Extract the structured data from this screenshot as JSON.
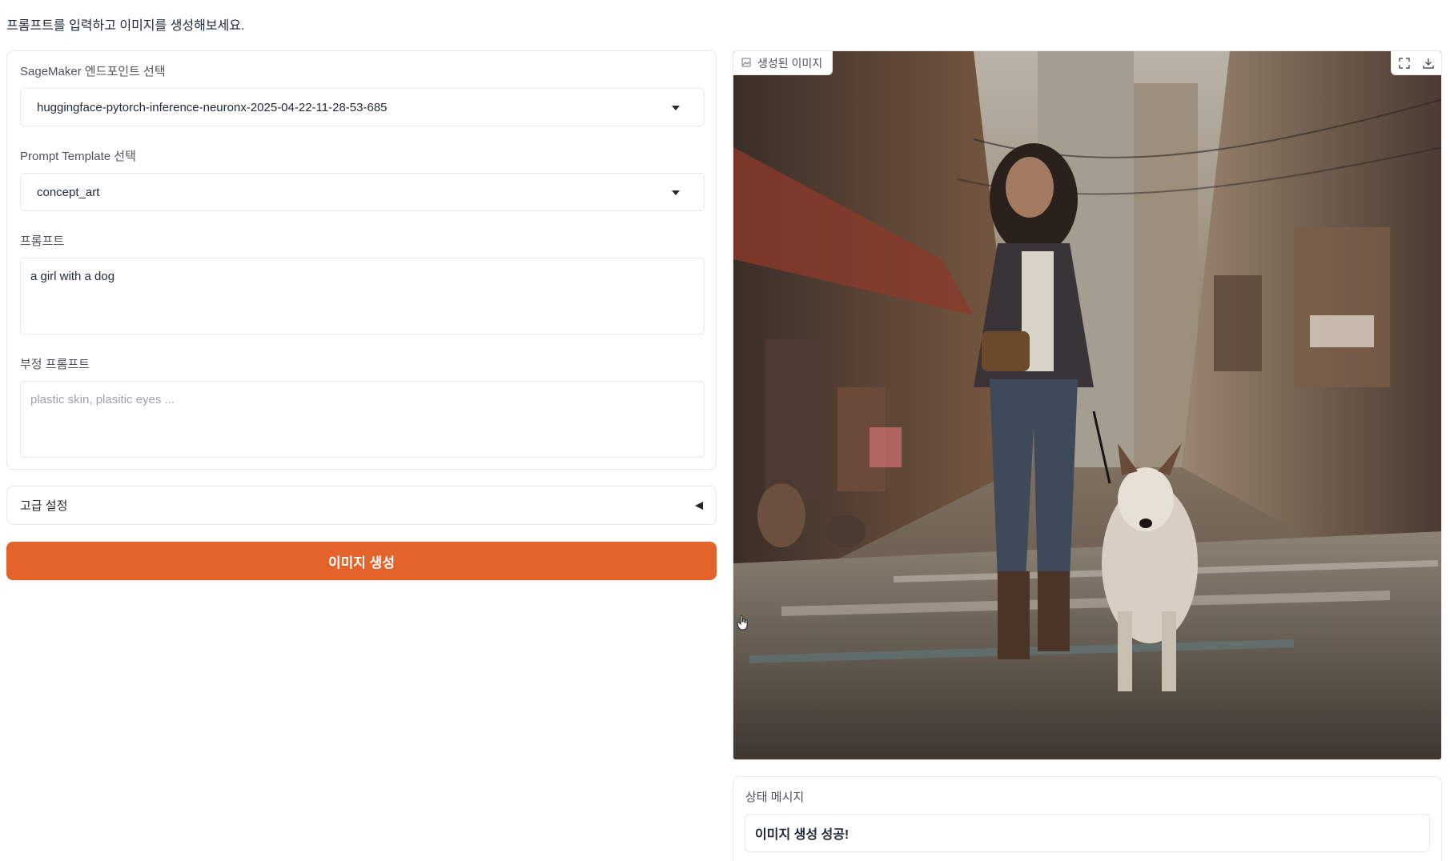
{
  "intro_text": "프롬프트를 입력하고 이미지를 생성해보세요.",
  "endpoint": {
    "label": "SageMaker 엔드포인트 선택",
    "value": "huggingface-pytorch-inference-neuronx-2025-04-22-11-28-53-685"
  },
  "template": {
    "label": "Prompt Template 선택",
    "value": "concept_art"
  },
  "prompt": {
    "label": "프롬프트",
    "value": "a girl with a dog"
  },
  "negative_prompt": {
    "label": "부정 프롬프트",
    "placeholder": "plastic skin, plasitic eyes ..."
  },
  "advanced": {
    "label": "고급 설정"
  },
  "generate_button": {
    "label": "이미지 생성"
  },
  "output_image": {
    "label": "생성된 이미지",
    "tools": [
      "fullscreen-icon",
      "download-icon"
    ]
  },
  "status": {
    "label": "상태 메시지",
    "value": "이미지 생성 성공!"
  },
  "colors": {
    "accent": "#e4632b",
    "border": "#e5e7eb"
  }
}
